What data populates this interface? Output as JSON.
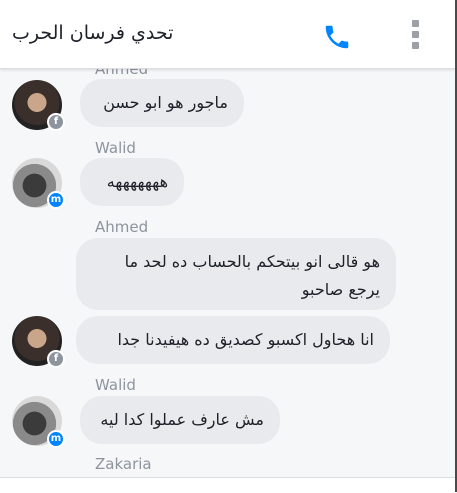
{
  "header": {
    "title": "تحدي فرسان الحرب",
    "call_icon": "phone-icon",
    "menu_icon": "more-vertical-icon",
    "accent_color": "#0084ff"
  },
  "messages": [
    {
      "sender": "Ahmed",
      "text": "ماجور هو ابو حسن",
      "badge_icon": "facebook-icon"
    },
    {
      "sender": "Walid",
      "text": "هههههههه",
      "badge_icon": "messenger-icon"
    },
    {
      "sender": "Ahmed",
      "lines": [
        "هو قالى انو بيتحكم بالحساب ده لحد ما",
        "يرجع صاحبو"
      ],
      "text2": "انا هحاول اكسبو كصديق ده هيفيدنا جدا",
      "badge_icon": "facebook-icon"
    },
    {
      "sender": "Walid",
      "text": "مش عارف عملوا كدا ليه",
      "badge_icon": "messenger-icon"
    },
    {
      "sender": "Zakaria"
    }
  ]
}
